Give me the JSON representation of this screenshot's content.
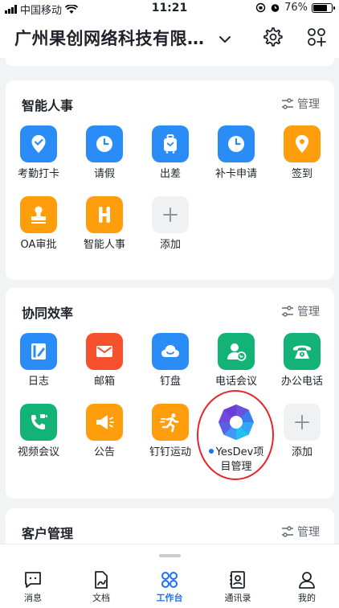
{
  "status_bar": {
    "carrier": "中国移动",
    "time": "11:21",
    "battery": "76%"
  },
  "header": {
    "org_name": "广州果创网络科技有限…"
  },
  "sections": {
    "hr": {
      "title": "智能人事",
      "manage": "管理",
      "apps": [
        "考勤打卡",
        "请假",
        "出差",
        "补卡申请",
        "签到",
        "OA审批",
        "智能人事",
        "添加"
      ]
    },
    "collab": {
      "title": "协同效率",
      "manage": "管理",
      "apps": [
        "日志",
        "邮箱",
        "钉盘",
        "电话会议",
        "办公电话",
        "视频会议",
        "公告",
        "钉钉运动",
        "YesDev项目管理",
        "添加"
      ]
    },
    "crm": {
      "title": "客户管理",
      "manage": "管理"
    }
  },
  "tabs": [
    "消息",
    "文档",
    "工作台",
    "通讯录",
    "我的"
  ],
  "colors": {
    "accent": "#1d6ff2",
    "blue": "#2a8cf7",
    "orange": "#ff9e0d",
    "green": "#13b377",
    "red": "#f5512c",
    "annotation": "#e8232a"
  }
}
